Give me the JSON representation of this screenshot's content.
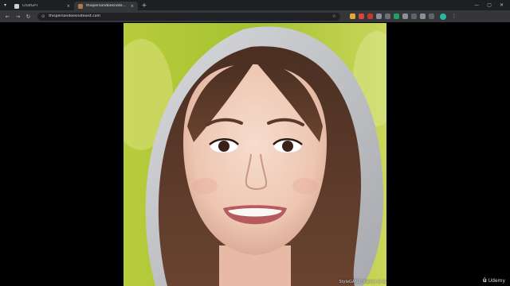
{
  "browser": {
    "tabs": [
      {
        "title": "ChatGPT",
        "active": false,
        "favicon_color": "#cfcfcf",
        "close_glyph": "×"
      },
      {
        "title": "thispersondoesnotexist.com (1",
        "active": true,
        "favicon_color": "#b07a48",
        "close_glyph": "×"
      }
    ],
    "new_tab_glyph": "+",
    "window_controls": {
      "minimize": "—",
      "maximize": "▢",
      "close": "✕"
    }
  },
  "toolbar": {
    "back_glyph": "←",
    "forward_glyph": "→",
    "reload_glyph": "↻",
    "site_info_glyph": "⊙",
    "url": "thispersondoesnotexist.com",
    "bookmark_glyph": "☆",
    "extensions": [
      {
        "name": "extension-1",
        "color": "#e9a43a"
      },
      {
        "name": "extension-2",
        "color": "#d6453d"
      },
      {
        "name": "extension-3",
        "color": "#c0392b"
      },
      {
        "name": "extension-4",
        "color": "#8a8f98"
      },
      {
        "name": "extension-5",
        "color": "#6c6f75"
      },
      {
        "name": "extension-6",
        "color": "#1ea362"
      },
      {
        "name": "extension-7",
        "color": "#8a8f98"
      },
      {
        "name": "extension-8",
        "color": "#5f6368"
      },
      {
        "name": "extension-9",
        "color": "#8a8f98"
      },
      {
        "name": "extension-10",
        "color": "#5f6368"
      }
    ],
    "menu_glyph": "⋮",
    "profile_color": "#2bb5a3"
  },
  "content": {
    "image_credit": "StyleGAN2 (Karras et al.",
    "watermark": {
      "logo_glyph": "û",
      "text": "Udemy"
    }
  }
}
